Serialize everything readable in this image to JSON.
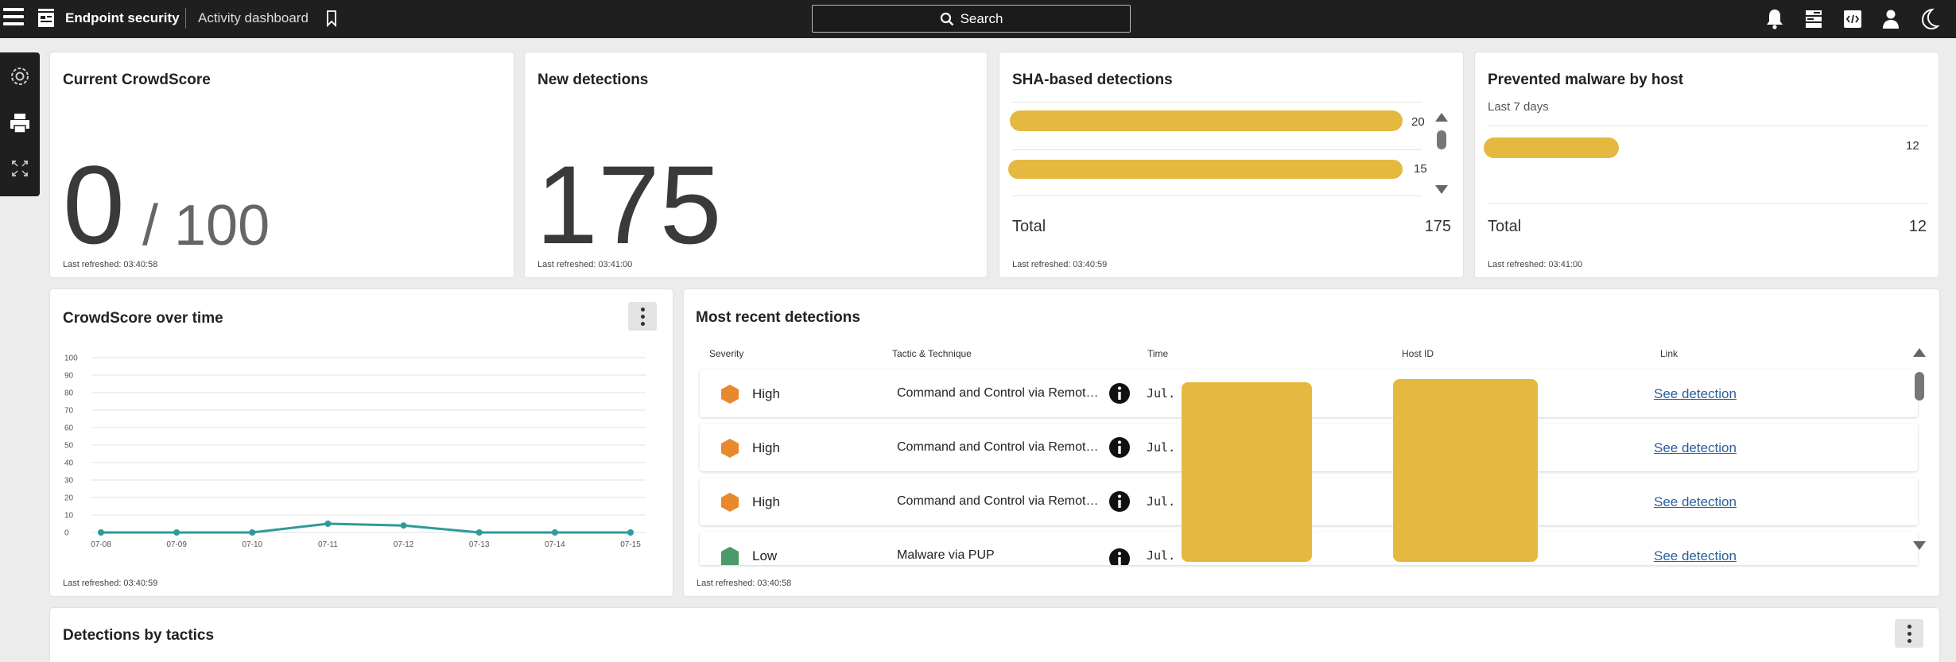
{
  "topbar": {
    "app_title": "Endpoint security",
    "page_title": "Activity dashboard",
    "search_label": "Search"
  },
  "colors": {
    "accent": "#e5b840",
    "high": "#e8892d",
    "low": "#4a9a6a",
    "line": "#2f9a9a",
    "link": "#2c5f9e"
  },
  "crowdscore": {
    "title": "Current CrowdScore",
    "value": "0",
    "max": "/ 100",
    "refreshed": "Last refreshed: 03:40:58"
  },
  "new_detections": {
    "title": "New detections",
    "value": "175",
    "refreshed": "Last refreshed: 03:41:00"
  },
  "sha": {
    "title": "SHA-based detections",
    "bars": [
      {
        "value": 20,
        "value_label": "20"
      },
      {
        "value": 15,
        "value_label": "15"
      }
    ],
    "total_label": "Total",
    "total_value": "175",
    "refreshed": "Last refreshed: 03:40:59"
  },
  "malware": {
    "title": "Prevented malware by host",
    "subtitle": "Last 7 days",
    "bars": [
      {
        "value": 12,
        "value_label": "12"
      }
    ],
    "total_label": "Total",
    "total_value": "12",
    "refreshed": "Last refreshed: 03:41:00"
  },
  "crowd_over_time": {
    "title": "CrowdScore over time",
    "refreshed": "Last refreshed: 03:40:59"
  },
  "chart_data": {
    "type": "line",
    "title": "CrowdScore over time",
    "x": [
      "07-08",
      "07-09",
      "07-10",
      "07-11",
      "07-12",
      "07-13",
      "07-14",
      "07-15"
    ],
    "y_ticks": [
      "0",
      "10",
      "20",
      "30",
      "40",
      "50",
      "60",
      "70",
      "80",
      "90",
      "100"
    ],
    "ylim": [
      0,
      100
    ],
    "grid": true,
    "series": [
      {
        "values": [
          0,
          0,
          0,
          5,
          4,
          0,
          0,
          0
        ]
      }
    ]
  },
  "recent": {
    "title": "Most recent detections",
    "columns": [
      "Severity",
      "Tactic & Technique",
      "Time",
      "Host ID",
      "Link"
    ],
    "rows": [
      {
        "severity": "High",
        "tactic": "Command and Control via Remot…",
        "time": "Jul.",
        "link": "See detection"
      },
      {
        "severity": "High",
        "tactic": "Command and Control via Remot…",
        "time": "Jul.",
        "link": "See detection"
      },
      {
        "severity": "High",
        "tactic": "Command and Control via Remot…",
        "time": "Jul.",
        "link": "See detection"
      },
      {
        "severity": "Low",
        "tactic": "Malware via PUP",
        "time": "Jul.",
        "link": "See detection"
      }
    ],
    "refreshed": "Last refreshed: 03:40:58"
  },
  "tactics": {
    "title": "Detections by tactics"
  }
}
